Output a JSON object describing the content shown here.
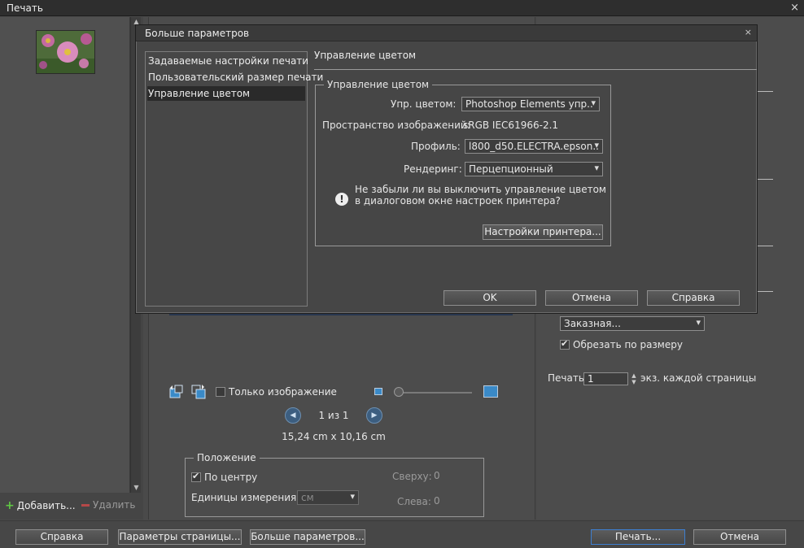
{
  "window": {
    "title": "Печать",
    "close_glyph": "×"
  },
  "left_pane": {
    "add_label": "Добавить...",
    "delete_label": "Удалить"
  },
  "center": {
    "only_image_label": "Только изображение",
    "page_counter": "1 из 1",
    "print_size": "15,24 cm x 10,16 cm",
    "position_group": {
      "legend": "Положение",
      "center_label": "По центру",
      "units_label": "Единицы измерения:",
      "units_value": "см",
      "top_label": "Сверху:",
      "top_value": "0",
      "left_label": "Слева:",
      "left_value": "0"
    }
  },
  "right": {
    "size_value": "Заказная...",
    "crop_label": "Обрезать по размеру",
    "print_label": "Печать",
    "copies_value": "1",
    "copies_suffix": "экз. каждой страницы"
  },
  "bottom": {
    "help": "Справка",
    "page_setup": "Параметры страницы...",
    "more_options": "Больше параметров...",
    "print": "Печать...",
    "cancel": "Отмена"
  },
  "dialog": {
    "title": "Больше параметров",
    "close_glyph": "×",
    "categories": [
      "Задаваемые настройки печати",
      "Пользовательский размер печати",
      "Управление цветом"
    ],
    "selected_category_index": 2,
    "section_title": "Управление цветом",
    "group_legend": "Управление цветом",
    "color_handling_label": "Упр. цветом:",
    "color_handling_value": "Photoshop Elements упр..",
    "image_space_label": "Пространство изображений:",
    "image_space_value": "sRGB IEC61966-2.1",
    "profile_label": "Профиль:",
    "profile_value": "l800_d50.ELECTRA.epson..",
    "rendering_label": "Рендеринг:",
    "rendering_value": "Перцепционный",
    "warning_line1": "Не забыли ли вы выключить управление цветом",
    "warning_line2": "в диалоговом окне настроек принтера?",
    "printer_settings": "Настройки принтера...",
    "ok": "OK",
    "cancel": "Отмена",
    "help": "Справка"
  }
}
